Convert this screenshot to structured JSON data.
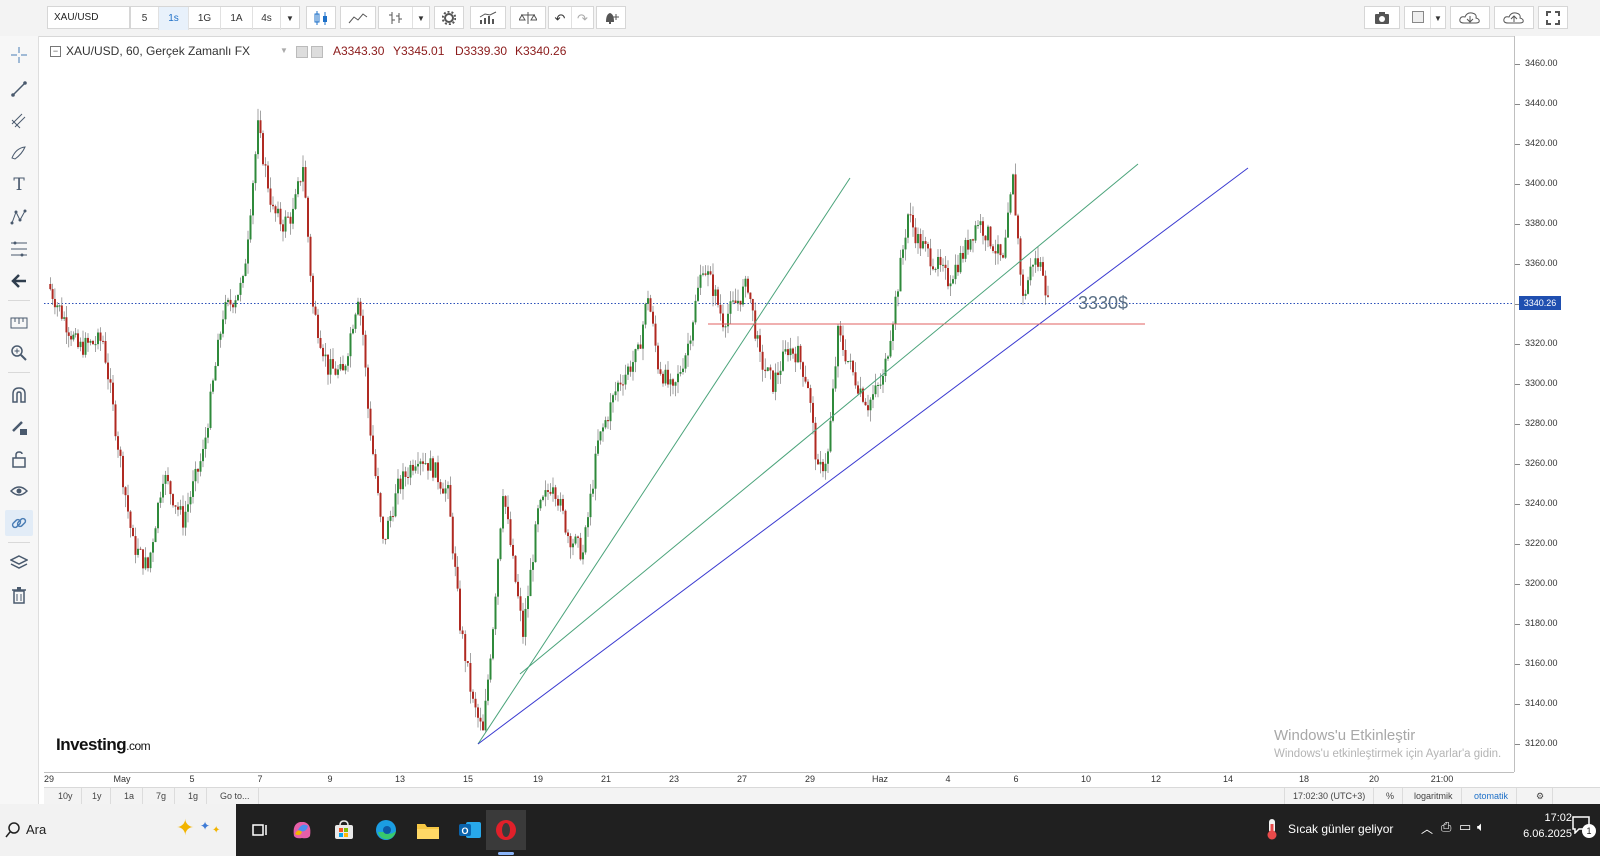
{
  "toolbar": {
    "symbol": "XAU/USD",
    "intervals": [
      "5",
      "1s",
      "1G",
      "1A",
      "4s"
    ],
    "active_interval": "1s",
    "icons": [
      "candles-icon",
      "line-chart-icon",
      "bar-chart-icon",
      "settings-icon",
      "indicators-icon",
      "compare-icon",
      "undo-icon",
      "redo-icon",
      "alert-icon"
    ],
    "right_icons": [
      "camera-icon",
      "layout-icon",
      "cloud-download-icon",
      "cloud-upload-icon",
      "fullscreen-icon"
    ]
  },
  "sidebar": {
    "icons": [
      "crosshair-icon",
      "trend-line-icon",
      "pitchfork-icon",
      "brush-icon",
      "text-icon",
      "pattern-icon",
      "fib-icon",
      "back-arrow-icon",
      "measure-icon",
      "zoom-in-icon",
      "magnet-icon",
      "pencil-lock-icon",
      "lock-icon",
      "eye-icon",
      "link-icon",
      "layers-icon",
      "trash-icon"
    ]
  },
  "legend": {
    "title": "XAU/USD, 60, Gerçek Zamanlı FX",
    "open": "A3343.30",
    "high": "Y3345.01",
    "low": "D3339.30",
    "close": "K3340.26"
  },
  "chart_data": {
    "type": "candlestick",
    "symbol": "XAU/USD",
    "interval": "60",
    "yticks": [
      3460,
      3440,
      3420,
      3400,
      3380,
      3360,
      3340,
      3320,
      3300,
      3280,
      3260,
      3240,
      3220,
      3200,
      3180,
      3160,
      3140,
      3120
    ],
    "ytick_labels": [
      "3460.00",
      "3440.00",
      "3420.00",
      "3400.00",
      "3380.00",
      "3360.00",
      "3340.00",
      "3320.00",
      "3300.00",
      "3280.00",
      "3260.00",
      "3240.00",
      "3220.00",
      "3200.00",
      "3180.00",
      "3160.00",
      "3140.00",
      "3120.00"
    ],
    "ylim": [
      3106,
      3474
    ],
    "current_price": 3340.26,
    "current_price_label": "3340.26",
    "xticks": [
      "29",
      "May",
      "5",
      "7",
      "9",
      "13",
      "15",
      "19",
      "21",
      "23",
      "27",
      "29",
      "Haz",
      "4",
      "6",
      "10",
      "12",
      "14",
      "18",
      "20",
      "21:00"
    ],
    "price_path": [
      [
        0,
        3350
      ],
      [
        30,
        3318
      ],
      [
        55,
        3322
      ],
      [
        70,
        3270
      ],
      [
        85,
        3220
      ],
      [
        100,
        3208
      ],
      [
        115,
        3255
      ],
      [
        135,
        3232
      ],
      [
        155,
        3265
      ],
      [
        175,
        3335
      ],
      [
        195,
        3350
      ],
      [
        210,
        3428
      ],
      [
        225,
        3386
      ],
      [
        235,
        3380
      ],
      [
        245,
        3385
      ],
      [
        255,
        3410
      ],
      [
        265,
        3338
      ],
      [
        280,
        3308
      ],
      [
        295,
        3305
      ],
      [
        310,
        3345
      ],
      [
        315,
        3325
      ],
      [
        320,
        3288
      ],
      [
        335,
        3220
      ],
      [
        350,
        3248
      ],
      [
        370,
        3265
      ],
      [
        385,
        3258
      ],
      [
        400,
        3245
      ],
      [
        412,
        3180
      ],
      [
        425,
        3140
      ],
      [
        435,
        3125
      ],
      [
        445,
        3180
      ],
      [
        455,
        3248
      ],
      [
        465,
        3210
      ],
      [
        475,
        3175
      ],
      [
        490,
        3235
      ],
      [
        505,
        3252
      ],
      [
        520,
        3225
      ],
      [
        535,
        3215
      ],
      [
        550,
        3270
      ],
      [
        570,
        3300
      ],
      [
        590,
        3315
      ],
      [
        600,
        3345
      ],
      [
        610,
        3310
      ],
      [
        625,
        3295
      ],
      [
        640,
        3320
      ],
      [
        655,
        3360
      ],
      [
        665,
        3348
      ],
      [
        675,
        3332
      ],
      [
        690,
        3342
      ],
      [
        700,
        3350
      ],
      [
        712,
        3312
      ],
      [
        725,
        3300
      ],
      [
        740,
        3318
      ],
      [
        750,
        3315
      ],
      [
        760,
        3300
      ],
      [
        770,
        3255
      ],
      [
        780,
        3265
      ],
      [
        790,
        3325
      ],
      [
        805,
        3305
      ],
      [
        820,
        3290
      ],
      [
        835,
        3302
      ],
      [
        850,
        3350
      ],
      [
        860,
        3385
      ],
      [
        870,
        3372
      ],
      [
        885,
        3362
      ],
      [
        900,
        3352
      ],
      [
        915,
        3365
      ],
      [
        930,
        3382
      ],
      [
        945,
        3370
      ],
      [
        955,
        3360
      ],
      [
        965,
        3402
      ],
      [
        975,
        3342
      ],
      [
        985,
        3362
      ],
      [
        995,
        3358
      ],
      [
        1000,
        3340
      ]
    ],
    "series": [
      {
        "kind": "trendline",
        "color": "#4aa37a",
        "x": [
          "May 15",
          "May 24"
        ],
        "y": [
          3120,
          3403
        ]
      },
      {
        "kind": "trendline",
        "color": "#4aa37a",
        "x": [
          "May 18",
          "Jun 10"
        ],
        "y": [
          3155,
          3410
        ]
      },
      {
        "kind": "trendline",
        "color": "#3a3ad0",
        "x": [
          "May 15",
          "Jun 13"
        ],
        "y": [
          3120,
          3408
        ]
      },
      {
        "kind": "horizontal",
        "color": "#e06060",
        "y": 3330
      }
    ],
    "annotation": "3330$"
  },
  "watermark": {
    "brand": "Investing",
    "brand_suffix": ".com",
    "activation_title": "Windows'u Etkinleştir",
    "activation_sub": "Windows'u etkinleştirmek için Ayarlar'a gidin."
  },
  "bottombar": {
    "ranges": [
      "10y",
      "1y",
      "1a",
      "7g",
      "1g",
      "Go to..."
    ],
    "time": "17:02:30 (UTC+3)",
    "percent": "%",
    "log": "logaritmik",
    "auto": "otomatik"
  },
  "taskbar": {
    "search": "Ara",
    "weather": "Sıcak günler geliyor",
    "clock_time": "17:02",
    "clock_date": "6.06.2025",
    "notif_count": "1"
  }
}
